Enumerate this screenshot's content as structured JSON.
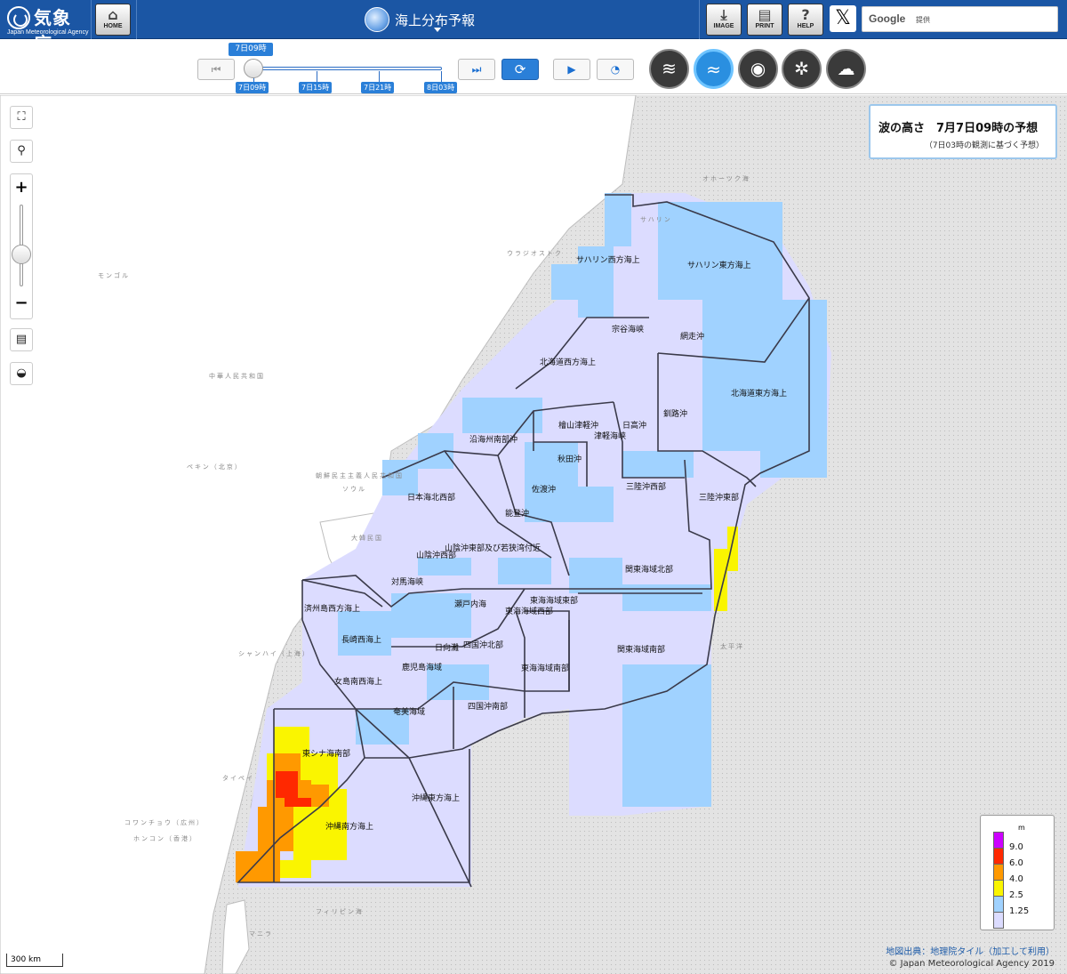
{
  "header": {
    "logo_name": "気象庁",
    "logo_sub": "Japan Meteorological Agency",
    "home_label": "HOME",
    "product_title": "海上分布予報",
    "image_label": "IMAGE",
    "print_label": "PRINT",
    "help_label": "HELP",
    "x_label": "𝕏",
    "search": {
      "brand": "Google",
      "placeholder": "提供"
    }
  },
  "timebar": {
    "current": "7日09時",
    "ticks": [
      "7日09時",
      "7日15時",
      "7日21時",
      "8日03時"
    ],
    "first_icon": "⏮",
    "last_icon": "⏭",
    "refresh_icon": "⟳",
    "play_icon": "▶",
    "speed_icon": "◔",
    "slider_position": 0
  },
  "elements": [
    {
      "name": "wind",
      "icon": "≋",
      "active": false
    },
    {
      "name": "wave",
      "icon": "≈",
      "active": true
    },
    {
      "name": "visibility",
      "icon": "◉",
      "active": false
    },
    {
      "name": "icing",
      "icon": "✲",
      "active": false
    },
    {
      "name": "weather",
      "icon": "☁",
      "active": false
    }
  ],
  "map_controls": {
    "fullscreen_icon": "⛶",
    "location_icon": "⚲",
    "zoom_in": "+",
    "zoom_out": "−",
    "basemap_icon": "▤",
    "opacity_icon": "◒"
  },
  "info": {
    "title": "波の高さ　7月7日09時の予想",
    "subtitle": "（7日03時の観測に基づく予想）"
  },
  "legend": {
    "unit": "m",
    "levels": [
      {
        "value": "9.0",
        "color": "#cc00ff"
      },
      {
        "value": "6.0",
        "color": "#ff2800"
      },
      {
        "value": "4.0",
        "color": "#ff9900"
      },
      {
        "value": "2.5",
        "color": "#faf500"
      },
      {
        "value": "1.25",
        "color": "#a0d2ff"
      },
      {
        "value": "",
        "color": "#dcdcff"
      }
    ]
  },
  "scale": "300 km",
  "credit": {
    "line1": "地図出典：地理院タイル（加工して利用）",
    "line2": "© Japan Meteorological Agency 2019"
  },
  "zones": [
    "サハリン西方海上",
    "サハリン東方海上",
    "宗谷海峡",
    "網走沖",
    "北海道西方海上",
    "北海道東方海上",
    "釧路沖",
    "日高沖",
    "檜山津軽沖",
    "津軽海峡",
    "沿海州南部沖",
    "秋田沖",
    "三陸沖西部",
    "三陸沖東部",
    "佐渡沖",
    "日本海北西部",
    "能登沖",
    "山陰沖東部及び若狭湾付近",
    "山陰沖西部",
    "関東海域北部",
    "対馬海峡",
    "瀬戸内海",
    "東海海域東部",
    "済州島西方海上",
    "東海海域西部",
    "長崎西海上",
    "日向灘",
    "四国沖北部",
    "関東海域南部",
    "鹿児島海域",
    "東海海域南部",
    "女島南西海上",
    "奄美海域",
    "四国沖南部",
    "東シナ海南部",
    "沖縄東方海上",
    "沖縄南方海上"
  ],
  "geo_labels": {
    "okhotsk": "オホーツク海",
    "pacific": "太平洋",
    "philippine": "フィリピン海",
    "sakhalin": "サハリン",
    "vladivostok": "ウラジオストク",
    "mongolia": "モンゴル",
    "china": "中華人民共和国",
    "korea_n": "朝鮮民主主義人民共和国",
    "korea_s": "大韓民国",
    "seoul": "ソウル",
    "beijing": "ペキン（北京）",
    "shanghai": "シャンハイ（上海）",
    "taiwan": "タイペイ",
    "guangzhou": "コワンチョウ（広州）",
    "hongkong": "ホンコン（香港）",
    "manila": "マニラ"
  }
}
